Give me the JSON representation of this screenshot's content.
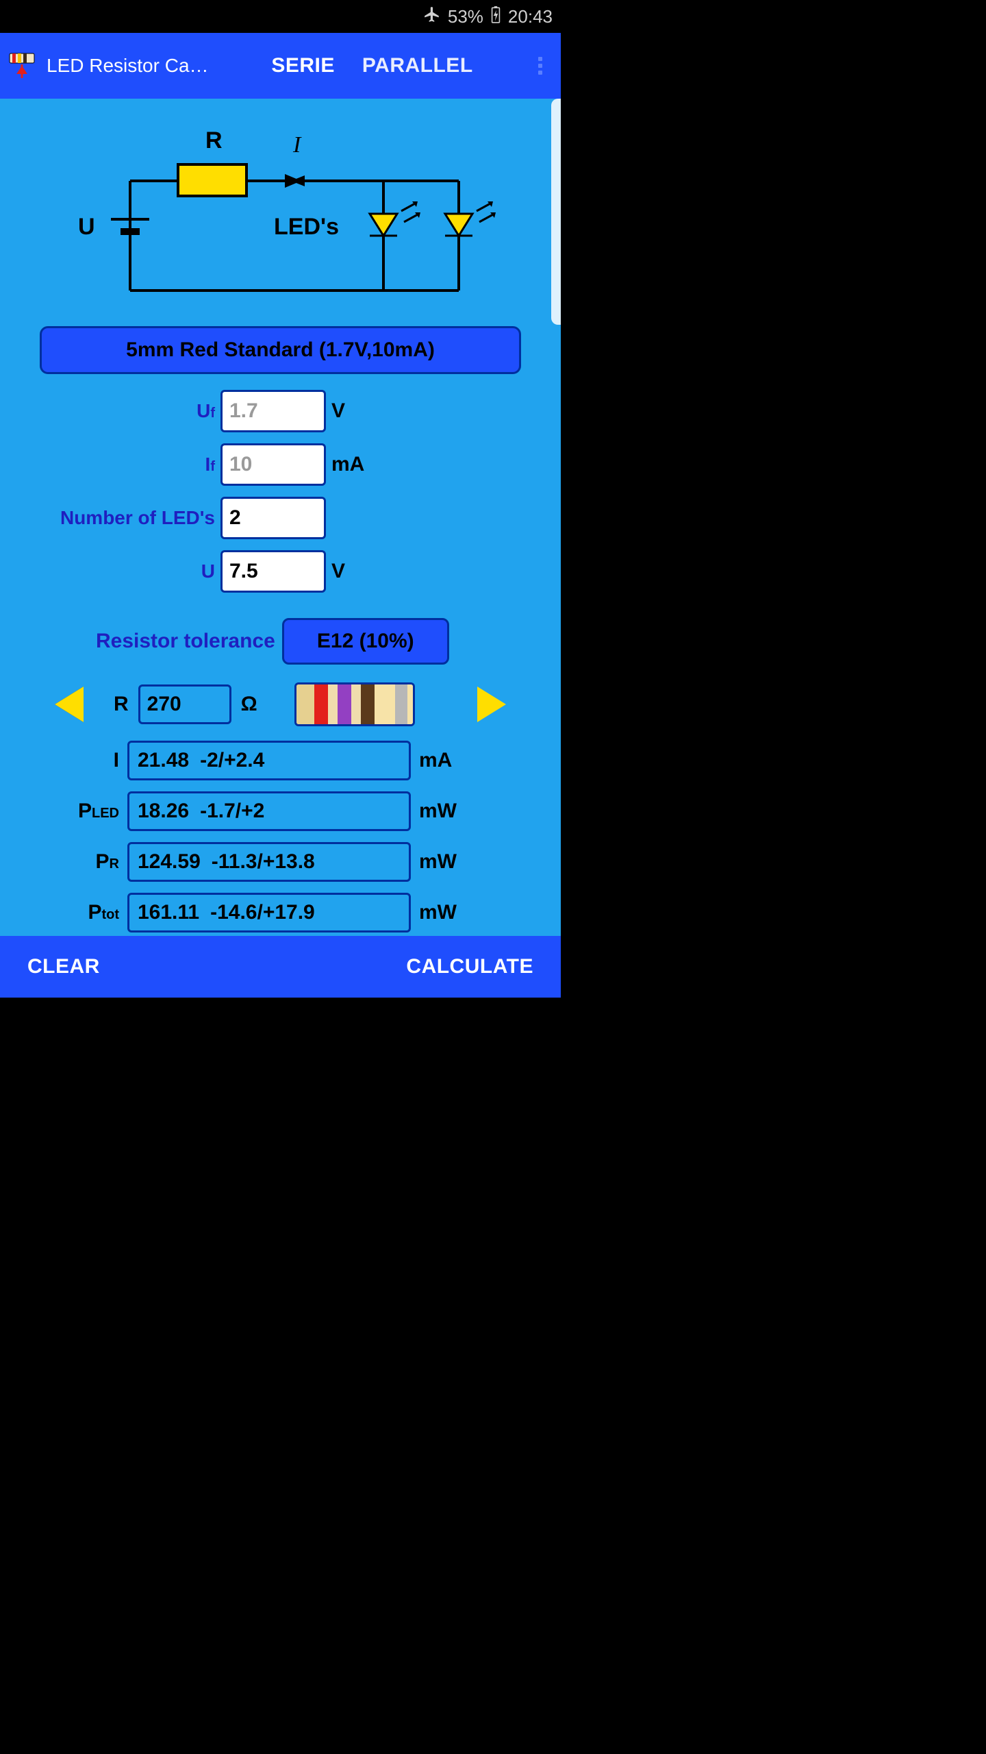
{
  "status": {
    "battery": "53%",
    "time": "20:43"
  },
  "app": {
    "title": "LED Resistor Ca…",
    "tab_serie": "SERIE",
    "tab_parallel": "PARALLEL"
  },
  "diagram": {
    "R": "R",
    "I": "I",
    "U": "U",
    "leds": "LED's"
  },
  "led_button": "5mm Red Standard (1.7V,10mA)",
  "inputs": {
    "uf_label": "Uf",
    "uf_value": "1.7",
    "uf_unit": "V",
    "if_label": "If",
    "if_value": "10",
    "if_unit": "mA",
    "num_label": "Number of LED's",
    "num_value": "2",
    "u_label": "U",
    "u_value": "7.5",
    "u_unit": "V"
  },
  "tolerance": {
    "label": "Resistor tolerance",
    "value": "E12 (10%)"
  },
  "r": {
    "label": "R",
    "value": "270",
    "unit": "Ω"
  },
  "results": {
    "i_label": "I",
    "i_val": "21.48",
    "i_tol": "-2/+2.4",
    "i_unit": "mA",
    "pled_label_main": "P",
    "pled_label_sub": "LED",
    "pled_val": "18.26",
    "pled_tol": "-1.7/+2",
    "pled_unit": "mW",
    "pr_label_main": "P",
    "pr_label_sub": "R",
    "pr_val": "124.59",
    "pr_tol": "-11.3/+13.8",
    "pr_unit": "mW",
    "ptot_label_main": "P",
    "ptot_label_sub": "tot",
    "ptot_val": "161.11",
    "ptot_tol": "-14.6/+17.9",
    "ptot_unit": "mW"
  },
  "bottom": {
    "clear": "CLEAR",
    "calculate": "CALCULATE"
  }
}
